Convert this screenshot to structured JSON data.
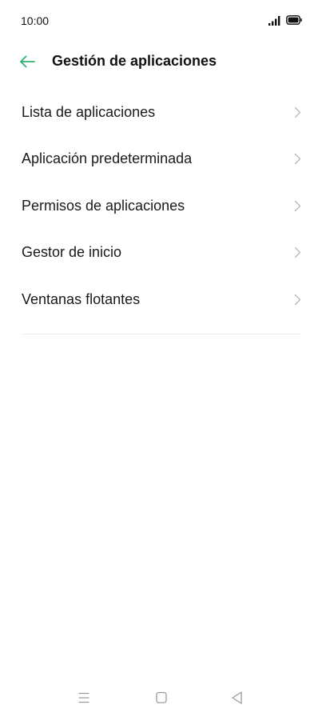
{
  "status_bar": {
    "time": "10:00",
    "icons": [
      "signal-icon",
      "battery-icon"
    ]
  },
  "header": {
    "back_icon": "arrow-left-icon",
    "title": "Gestión de aplicaciones",
    "accent_color": "#2fb36c"
  },
  "menu": {
    "items": [
      {
        "label": "Lista de aplicaciones"
      },
      {
        "label": "Aplicación predeterminada"
      },
      {
        "label": "Permisos de aplicaciones"
      },
      {
        "label": "Gestor de inicio"
      },
      {
        "label": "Ventanas flotantes"
      }
    ],
    "trailing_icon": "chevron-right-icon"
  },
  "nav_bar": {
    "icons": [
      "menu-icon",
      "home-square-icon",
      "back-triangle-icon"
    ]
  }
}
